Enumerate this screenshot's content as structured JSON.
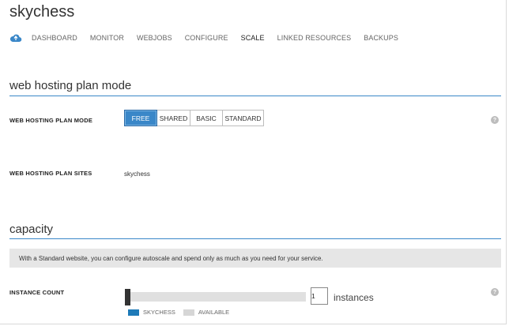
{
  "site": {
    "title": "skychess"
  },
  "nav": {
    "items": [
      {
        "label": "DASHBOARD"
      },
      {
        "label": "MONITOR"
      },
      {
        "label": "WEBJOBS"
      },
      {
        "label": "CONFIGURE"
      },
      {
        "label": "SCALE",
        "active": true
      },
      {
        "label": "LINKED RESOURCES"
      },
      {
        "label": "BACKUPS"
      }
    ]
  },
  "plan_section": {
    "heading": "web hosting plan mode",
    "mode_label": "WEB HOSTING PLAN MODE",
    "modes": [
      "FREE",
      "SHARED",
      "BASIC",
      "STANDARD"
    ],
    "selected_mode": "FREE",
    "sites_label": "WEB HOSTING PLAN SITES",
    "sites_value": "skychess"
  },
  "capacity": {
    "heading": "capacity",
    "info": "With a Standard website, you can configure autoscale and spend only as much as you need for your service.",
    "instance_label": "INSTANCE COUNT",
    "instance_value": "1",
    "instance_unit": "instances",
    "legend": [
      {
        "label": "SKYCHESS",
        "color": "#1e7ab8"
      },
      {
        "label": "AVAILABLE",
        "color": "#d6d6d6"
      }
    ]
  },
  "help_glyph": "?",
  "colors": {
    "accent": "#3a87c8",
    "handle": "#333333",
    "track": "#e0e0e0"
  }
}
